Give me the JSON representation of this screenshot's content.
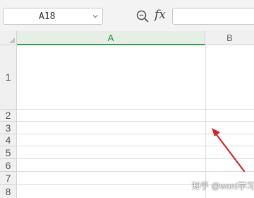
{
  "formula_bar": {
    "name_box_value": "A18",
    "zoom_icon": "zoom-search-icon",
    "fx_label": "fx",
    "formula_value": ""
  },
  "grid": {
    "columns": [
      "A",
      "B"
    ],
    "active_column": "A",
    "rows": [
      "1",
      "2",
      "3",
      "4",
      "5",
      "6",
      "7",
      "8"
    ]
  },
  "annotation": {
    "arrow_icon": "red-arrow-icon",
    "arrow_color": "#d0282a"
  },
  "watermark": "知乎 @word学习",
  "colors": {
    "active_header_bg": "#e5efe5",
    "active_header_text": "#2f8a3e",
    "header_bg": "#f0f0f0"
  }
}
